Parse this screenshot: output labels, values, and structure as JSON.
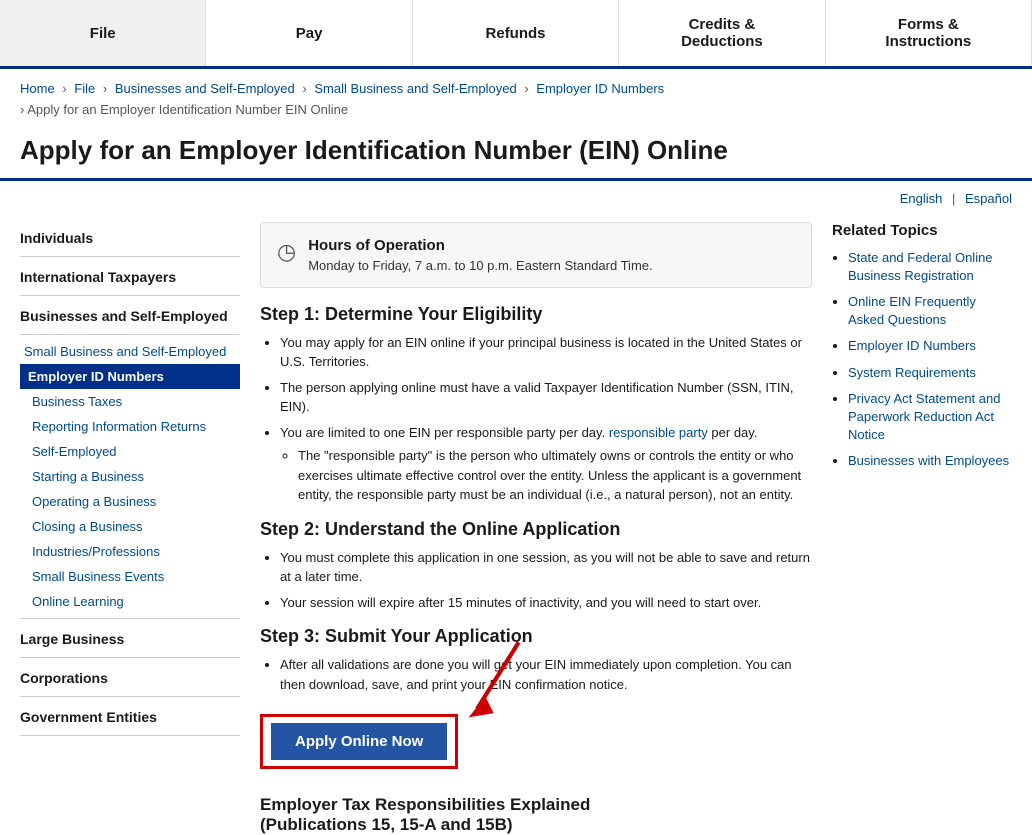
{
  "nav": {
    "items": [
      {
        "id": "file",
        "label": "File"
      },
      {
        "id": "pay",
        "label": "Pay"
      },
      {
        "id": "refunds",
        "label": "Refunds"
      },
      {
        "id": "credits",
        "label": "Credits & Deductions"
      },
      {
        "id": "forms",
        "label": "Forms & Instructions"
      }
    ]
  },
  "breadcrumb": {
    "items": [
      {
        "label": "Home",
        "href": "#"
      },
      {
        "label": "File",
        "href": "#"
      },
      {
        "label": "Businesses and Self-Employed",
        "href": "#"
      },
      {
        "label": "Small Business and Self-Employed",
        "href": "#"
      },
      {
        "label": "Employer ID Numbers",
        "href": "#"
      }
    ],
    "current": "Apply for an Employer Identification Number EIN Online"
  },
  "page_title": "Apply for an Employer Identification Number (EIN) Online",
  "lang": {
    "english": "English",
    "separator": "|",
    "espanol": "Español"
  },
  "hours": {
    "title": "Hours of Operation",
    "text": "Monday to Friday, 7 a.m. to 10 p.m. Eastern Standard Time."
  },
  "steps": [
    {
      "heading": "Step 1: Determine Your Eligibility",
      "bullets": [
        "You may apply for an EIN online if your principal business is located in the United States or U.S. Territories.",
        "The person applying online must have a valid Taxpayer Identification Number (SSN, ITIN, EIN).",
        "You are limited to one EIN per responsible party per day."
      ],
      "sub_bullets": [
        "The \"responsible party\" is the person who ultimately owns or controls the entity or who exercises ultimate effective control over the entity. Unless the applicant is a government entity, the responsible party must be an individual (i.e., a natural person), not an entity."
      ]
    },
    {
      "heading": "Step 2: Understand the Online Application",
      "bullets": [
        "You must complete this application in one session, as you will not be able to save and return at a later time.",
        "Your session will expire after 15 minutes of inactivity, and you will need to start over."
      ]
    },
    {
      "heading": "Step 3: Submit Your Application",
      "bullets": [
        "After all validations are done you will get your EIN immediately upon completion. You can then download, save, and print your EIN confirmation notice."
      ]
    }
  ],
  "apply_button_label": "Apply Online Now",
  "employer_tax_heading": "Employer Tax Responsibilities Explained\n(Publications 15, 15-A and 15B)",
  "sidebar": {
    "sections": [
      {
        "label": "Individuals",
        "items": []
      },
      {
        "label": "International Taxpayers",
        "items": []
      },
      {
        "label": "Businesses and Self-Employed",
        "items": [
          {
            "label": "Small Business and Self-Employed",
            "type": "subsection"
          },
          {
            "label": "Employer ID Numbers",
            "type": "active"
          },
          {
            "label": "Business Taxes",
            "type": "item"
          },
          {
            "label": "Reporting Information Returns",
            "type": "item"
          },
          {
            "label": "Self-Employed",
            "type": "item"
          },
          {
            "label": "Starting a Business",
            "type": "item"
          },
          {
            "label": "Operating a Business",
            "type": "item"
          },
          {
            "label": "Closing a Business",
            "type": "item"
          },
          {
            "label": "Industries/Professions",
            "type": "item"
          },
          {
            "label": "Small Business Events",
            "type": "item"
          },
          {
            "label": "Online Learning",
            "type": "item"
          }
        ]
      },
      {
        "label": "Large Business",
        "items": []
      },
      {
        "label": "Corporations",
        "items": []
      },
      {
        "label": "Government Entities",
        "items": []
      }
    ]
  },
  "related_topics": {
    "title": "Related Topics",
    "links": [
      {
        "label": "State and Federal Online Business Registration"
      },
      {
        "label": "Online EIN Frequently Asked Questions"
      },
      {
        "label": "Employer ID Numbers"
      },
      {
        "label": "System Requirements"
      },
      {
        "label": "Privacy Act Statement and Paperwork Reduction Act Notice"
      },
      {
        "label": "Businesses with Employees"
      }
    ]
  }
}
